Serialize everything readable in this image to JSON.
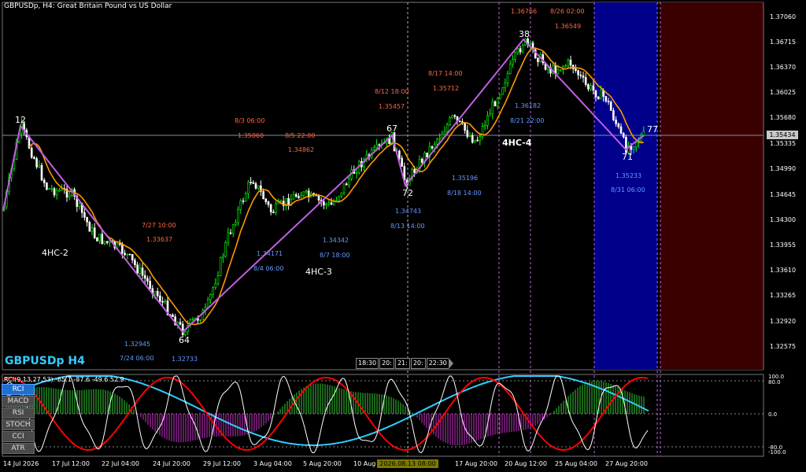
{
  "window": {
    "title": "GBPUSDp, H4:  Great Britain Pound vs US Dollar",
    "symbol_badge": "GBPUSDp H4"
  },
  "colors": {
    "background": "#000000",
    "candle_up": "#00ff00",
    "candle_down": "#ffffff",
    "wave_line": "#c060e0",
    "moving_average": "#ff9900",
    "low_label": "#6699ff",
    "high_label": "#ff6644",
    "blue_zone": "#00008b",
    "red_zone": "#3a0000",
    "rci_short": "#ffffff",
    "rci_mid": "#ff0000",
    "rci_long": "#33ccff",
    "hist_positive": "#33cc33",
    "hist_negative": "#cc33cc"
  },
  "price_axis": {
    "ticks": [
      "1.37060",
      "1.36715",
      "1.36370",
      "1.36025",
      "1.35680",
      "1.35335",
      "1.34990",
      "1.34645",
      "1.34300",
      "1.33955",
      "1.33610",
      "1.33265",
      "1.32920",
      "1.32575"
    ],
    "current_price": "1.35434"
  },
  "time_axis": {
    "labels": [
      "14 Jul 2026",
      "17 Jul 12:00",
      "22 Jul 04:00",
      "24 Jul 20:00",
      "29 Jul 12:00",
      "3 Aug 04:00",
      "5 Aug 20:00",
      "10 Aug 12:00",
      "17 Aug 20:00",
      "20 Aug 12:00",
      "25 Aug 04:00",
      "27 Aug 20:00"
    ],
    "highlight": "2026.08.13 08:00",
    "time_boxes": [
      "18:30",
      "20:",
      "21:",
      "20:",
      "22:30"
    ]
  },
  "wave_labels": {
    "counts": [
      "12",
      "64",
      "67",
      "72",
      "38",
      "71",
      "77"
    ],
    "patterns": [
      "4HC-2",
      "4HC-3",
      "4HC-4"
    ]
  },
  "annotations": {
    "lows": [
      {
        "price": "1.32945",
        "time": "7/24 06:00"
      },
      {
        "price": "1.32733"
      },
      {
        "price": "1.34171",
        "time": "8/4 06:00"
      },
      {
        "price": "1.34342",
        "time": "8/7 18:00"
      },
      {
        "price": "1.34743",
        "time": "8/13 14:00"
      },
      {
        "price": "1.35196",
        "time": "8/18 14:00"
      },
      {
        "price": "1.36182",
        "time": "8/21 22:00"
      },
      {
        "price": "1.35233",
        "time": "8/31 06:00"
      }
    ],
    "highs": [
      {
        "time": "7/27 10:00",
        "price": "1.33637"
      },
      {
        "time": "8/3 06:00",
        "price": "1.35060"
      },
      {
        "time": "8/5 22:00",
        "price": "1.34862"
      },
      {
        "time": "8/12 18:00",
        "price": "1.35457"
      },
      {
        "time": "8/17 14:00",
        "price": "1.35712"
      },
      {
        "price": "1.36766"
      },
      {
        "time": "8/26 02:00",
        "price": "1.36549"
      }
    ]
  },
  "oscillator": {
    "title": "RCI(9,13,27,53) -65.1 -87.6 -49.6 52.9",
    "axis_ticks": [
      "100.0",
      "80.0",
      "0.0",
      "-80.0",
      "-100.0"
    ],
    "tabs": [
      "RCI",
      "MACD",
      "RSI",
      "STOCH",
      "CCI",
      "ATR"
    ],
    "active_tab": "RCI"
  }
}
